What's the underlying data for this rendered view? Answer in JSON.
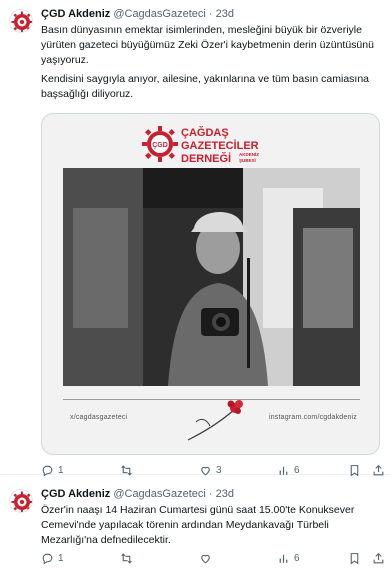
{
  "tweets": [
    {
      "author": {
        "display_name": "ÇGD Akdeniz",
        "handle": "@CagdasGazeteci",
        "separator": "·",
        "time": "23d"
      },
      "paragraphs": [
        "Basın dünyasının emektar isimlerinden, mesleğini büyük bir özveriyle yürüten gazeteci büyüğümüz Zeki Özer'i kaybetmenin derin üzüntüsünü yaşıyoruz.",
        "Kendisini saygıyla anıyor, ailesine, yakınlarına ve tüm basın camiasına başsağlığı diliyoruz."
      ],
      "media": {
        "logo": {
          "line1": "ÇAĞDAŞ",
          "line2": "GAZETECİLER",
          "line3": "DERNEĞİ",
          "branch_line1": "AKDENİZ",
          "branch_line2": "ŞUBESİ",
          "seal_text": "ÇGD"
        },
        "footer_left": "x/cagdasgazeteci",
        "footer_right": "instagram.com/cgdakdeniz"
      },
      "actions": {
        "replies": "1",
        "retweets": "",
        "likes": "3",
        "views": "6"
      }
    },
    {
      "author": {
        "display_name": "ÇGD Akdeniz",
        "handle": "@CagdasGazeteci",
        "separator": "·",
        "time": "23d"
      },
      "paragraphs": [
        "Özer'in naaşı 14 Haziran Cumartesi günü saat 15.00'te Konuksever Cemevi'nde yapılacak törenin ardından Meydankavağı Türbeli Mezarlığı'na defnedilecektir."
      ],
      "actions": {
        "replies": "1",
        "retweets": "",
        "likes": "",
        "views": "6"
      }
    }
  ],
  "colors": {
    "brand_red": "#c8202f",
    "text": "#0f1419",
    "muted": "#536471",
    "border": "#cfd9de"
  },
  "icons": [
    "reply-icon",
    "retweet-icon",
    "like-icon",
    "views-icon",
    "bookmark-icon",
    "share-icon"
  ]
}
